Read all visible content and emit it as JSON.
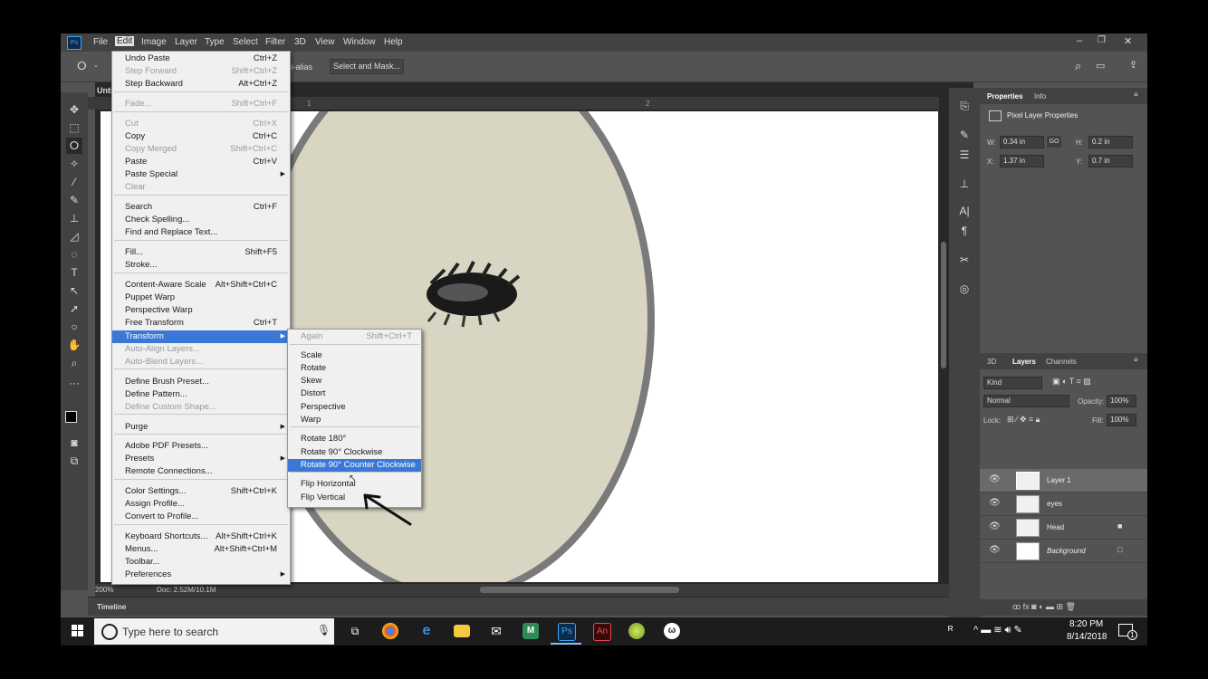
{
  "menubar": {
    "items": [
      "File",
      "Edit",
      "Image",
      "Layer",
      "Type",
      "Select",
      "Filter",
      "3D",
      "View",
      "Window",
      "Help"
    ]
  },
  "options_bar": {
    "antialias_label": "ti-alias",
    "select_and_mask_label": "Select and Mask..."
  },
  "document": {
    "tab_title": "Unti",
    "ruler_marks": [
      "1",
      "2"
    ],
    "zoom": "200%",
    "doc_info": "Doc: 2.52M/10.1M"
  },
  "timeline": {
    "label": "Timeline"
  },
  "edit_menu": {
    "items": [
      {
        "label": "Undo Paste",
        "shortcut": "Ctrl+Z",
        "disabled": false
      },
      {
        "label": "Step Forward",
        "shortcut": "Shift+Ctrl+Z",
        "disabled": true
      },
      {
        "label": "Step Backward",
        "shortcut": "Alt+Ctrl+Z",
        "disabled": false
      },
      {
        "label": "Fade...",
        "shortcut": "Shift+Ctrl+F",
        "disabled": true
      },
      {
        "label": "Cut",
        "shortcut": "Ctrl+X",
        "disabled": true
      },
      {
        "label": "Copy",
        "shortcut": "Ctrl+C",
        "disabled": false
      },
      {
        "label": "Copy Merged",
        "shortcut": "Shift+Ctrl+C",
        "disabled": true
      },
      {
        "label": "Paste",
        "shortcut": "Ctrl+V",
        "disabled": false
      },
      {
        "label": "Paste Special",
        "shortcut": "",
        "disabled": false
      },
      {
        "label": "Clear",
        "shortcut": "",
        "disabled": true
      },
      {
        "label": "Search",
        "shortcut": "Ctrl+F",
        "disabled": false
      },
      {
        "label": "Check Spelling...",
        "shortcut": "",
        "disabled": false
      },
      {
        "label": "Find and Replace Text...",
        "shortcut": "",
        "disabled": false
      },
      {
        "label": "Fill...",
        "shortcut": "Shift+F5",
        "disabled": false
      },
      {
        "label": "Stroke...",
        "shortcut": "",
        "disabled": false
      },
      {
        "label": "Content-Aware Scale",
        "shortcut": "Alt+Shift+Ctrl+C",
        "disabled": false
      },
      {
        "label": "Puppet Warp",
        "shortcut": "",
        "disabled": false
      },
      {
        "label": "Perspective Warp",
        "shortcut": "",
        "disabled": false
      },
      {
        "label": "Free Transform",
        "shortcut": "Ctrl+T",
        "disabled": false
      },
      {
        "label": "Transform",
        "shortcut": "",
        "disabled": false
      },
      {
        "label": "Auto-Align Layers...",
        "shortcut": "",
        "disabled": true
      },
      {
        "label": "Auto-Blend Layers...",
        "shortcut": "",
        "disabled": true
      },
      {
        "label": "Define Brush Preset...",
        "shortcut": "",
        "disabled": false
      },
      {
        "label": "Define Pattern...",
        "shortcut": "",
        "disabled": false
      },
      {
        "label": "Define Custom Shape...",
        "shortcut": "",
        "disabled": true
      },
      {
        "label": "Purge",
        "shortcut": "",
        "disabled": false
      },
      {
        "label": "Adobe PDF Presets...",
        "shortcut": "",
        "disabled": false
      },
      {
        "label": "Presets",
        "shortcut": "",
        "disabled": false
      },
      {
        "label": "Remote Connections...",
        "shortcut": "",
        "disabled": false
      },
      {
        "label": "Color Settings...",
        "shortcut": "Shift+Ctrl+K",
        "disabled": false
      },
      {
        "label": "Assign Profile...",
        "shortcut": "",
        "disabled": false
      },
      {
        "label": "Convert to Profile...",
        "shortcut": "",
        "disabled": false
      },
      {
        "label": "Keyboard Shortcuts...",
        "shortcut": "Alt+Shift+Ctrl+K",
        "disabled": false
      },
      {
        "label": "Menus...",
        "shortcut": "Alt+Shift+Ctrl+M",
        "disabled": false
      },
      {
        "label": "Toolbar...",
        "shortcut": "",
        "disabled": false
      },
      {
        "label": "Preferences",
        "shortcut": "",
        "disabled": false
      }
    ]
  },
  "transform_menu": {
    "items": [
      {
        "label": "Again",
        "shortcut": "Shift+Ctrl+T",
        "disabled": true
      },
      {
        "label": "Scale",
        "shortcut": "",
        "disabled": false
      },
      {
        "label": "Rotate",
        "shortcut": "",
        "disabled": false
      },
      {
        "label": "Skew",
        "shortcut": "",
        "disabled": false
      },
      {
        "label": "Distort",
        "shortcut": "",
        "disabled": false
      },
      {
        "label": "Perspective",
        "shortcut": "",
        "disabled": false
      },
      {
        "label": "Warp",
        "shortcut": "",
        "disabled": false
      },
      {
        "label": "Rotate 180°",
        "shortcut": "",
        "disabled": false
      },
      {
        "label": "Rotate 90° Clockwise",
        "shortcut": "",
        "disabled": false
      },
      {
        "label": "Rotate 90° Counter Clockwise",
        "shortcut": "",
        "disabled": false
      },
      {
        "label": "Flip Horizontal",
        "shortcut": "",
        "disabled": false
      },
      {
        "label": "Flip Vertical",
        "shortcut": "",
        "disabled": false
      }
    ]
  },
  "properties_panel": {
    "tabs": [
      "Properties",
      "Info"
    ],
    "section_title": "Pixel Layer Properties",
    "w_label": "W:",
    "w_value": "0.34 in",
    "h_label": "H:",
    "h_value": "0.2 in",
    "x_label": "X:",
    "x_value": "1.37 in",
    "y_label": "Y:",
    "y_value": "0.7 in",
    "link_label": "GO"
  },
  "layers_panel": {
    "tabs": [
      "3D",
      "Layers",
      "Channels"
    ],
    "filter_kind": "Kind",
    "blend_mode": "Normal",
    "opacity_label": "Opacity:",
    "opacity_value": "100%",
    "lock_label": "Lock:",
    "fill_label": "Fill:",
    "fill_value": "100%",
    "layers": [
      {
        "name": "Layer 1",
        "selected": true,
        "locked": false
      },
      {
        "name": "eyes",
        "selected": false,
        "locked": false
      },
      {
        "name": "Head",
        "selected": false,
        "locked": true
      },
      {
        "name": "Background",
        "selected": false,
        "locked": true
      }
    ]
  },
  "taskbar": {
    "search_placeholder": "Type here to search",
    "time": "8:20 PM",
    "date": "8/14/2018",
    "notification_count": "1"
  },
  "colors": {
    "face_fill": "#d8d6c2",
    "face_stroke": "#7a7a7a",
    "menu_highlight": "#3b78d6",
    "ps_bg": "#535353"
  }
}
